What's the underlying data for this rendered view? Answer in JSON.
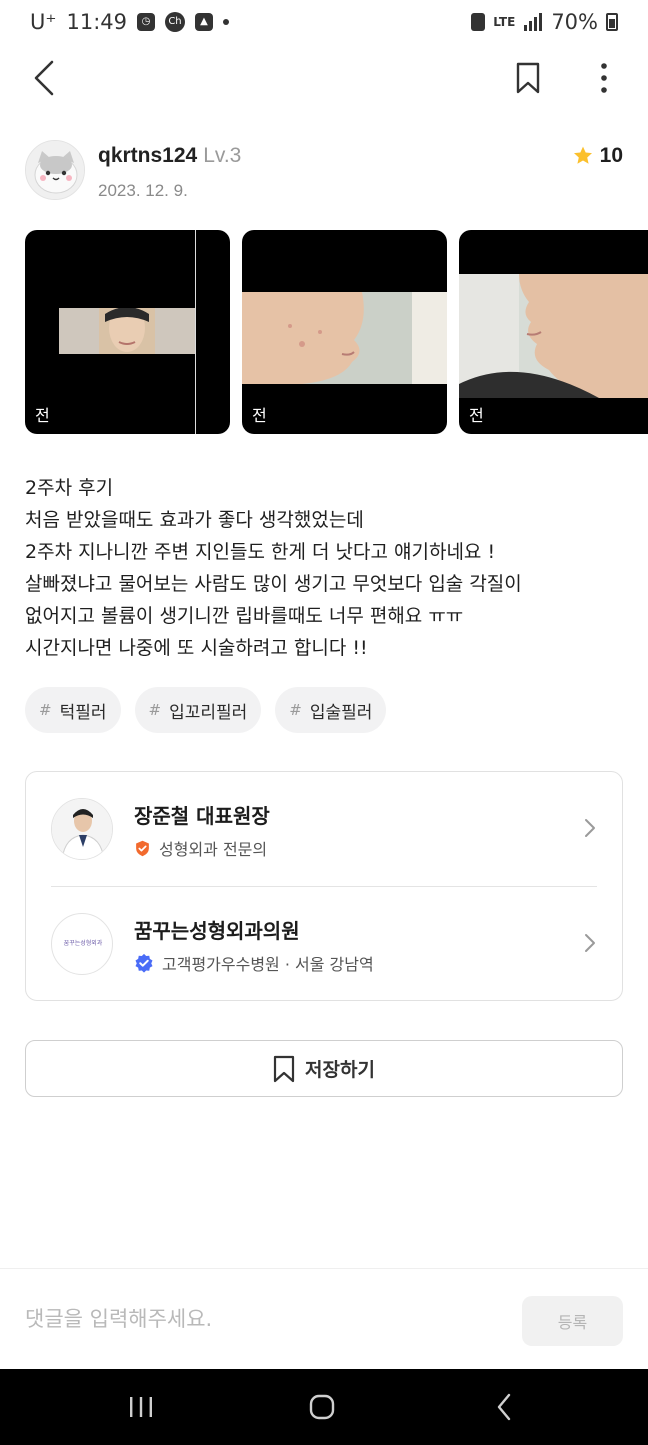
{
  "status_bar": {
    "carrier": "U⁺",
    "time": "11:49",
    "network": "LTE",
    "battery": "70%",
    "icons": [
      "clock-icon",
      "chat-icon",
      "gallery-icon",
      "notification-dot-icon",
      "cleaner-icon",
      "lte-icon",
      "signal-icon",
      "battery-icon"
    ]
  },
  "nav": {
    "icons": [
      "back-arrow-icon",
      "bookmark-icon",
      "more-vertical-icon"
    ]
  },
  "author": {
    "username": "qkrtns124",
    "level": "Lv.3",
    "date": "2023. 12. 9.",
    "rating": "10",
    "rating_color": "#FBC02D"
  },
  "photos": [
    {
      "label": "전"
    },
    {
      "label": "전"
    },
    {
      "label": "전"
    }
  ],
  "body": {
    "lines": [
      "2주차 후기",
      "처음 받았을때도 효과가 좋다 생각했었는데",
      "2주차 지나니깐 주변 지인들도 한게 더 낫다고 얘기하네요 !",
      "살빠졌냐고 물어보는 사람도 많이 생기고 무엇보다 입술 각질이",
      "없어지고 볼륨이 생기니깐 립바를때도 너무 편해요 ㅠㅠ",
      "시간지나면 나중에 또 시술하려고 합니다 !!"
    ]
  },
  "tags": [
    {
      "hash": "#",
      "label": "턱필러"
    },
    {
      "hash": "#",
      "label": "입꼬리필러"
    },
    {
      "hash": "#",
      "label": "입술필러"
    }
  ],
  "doctor": {
    "name": "장준철 대표원장",
    "specialty": "성형외과 전문의",
    "badge_color": "#F26A2E"
  },
  "clinic": {
    "name": "꿈꾸는성형외과의원",
    "info": "고객평가우수병원 · 서울 강남역",
    "logo_text": "꿈꾸는성형외과",
    "badge_color": "#4A6CF7"
  },
  "save_button": {
    "label": "저장하기"
  },
  "comment": {
    "placeholder": "댓글을 입력해주세요.",
    "submit_label": "등록"
  },
  "android_nav": {
    "icons": [
      "recent-apps-icon",
      "home-icon",
      "back-icon"
    ]
  }
}
